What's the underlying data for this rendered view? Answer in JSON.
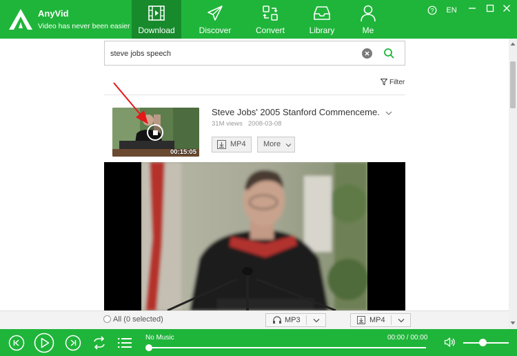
{
  "app": {
    "name": "AnyVid",
    "slogan": "Video has never been easier"
  },
  "nav": {
    "tabs": [
      {
        "label": "Download",
        "icon": "film-icon",
        "active": true
      },
      {
        "label": "Discover",
        "icon": "paper-plane-icon",
        "active": false
      },
      {
        "label": "Convert",
        "icon": "convert-icon",
        "active": false
      },
      {
        "label": "Library",
        "icon": "inbox-icon",
        "active": false
      },
      {
        "label": "Me",
        "icon": "user-icon",
        "active": false
      }
    ]
  },
  "window": {
    "help": "?",
    "language": "EN"
  },
  "search": {
    "value": "steve jobs speech",
    "placeholder": ""
  },
  "filter": {
    "label": "Filter"
  },
  "result": {
    "title": "Steve Jobs' 2005 Stanford Commenceme...",
    "views": "31M views",
    "date": "2008-03-08",
    "duration": "00:15:05",
    "format_button": "MP4",
    "more_button": "More"
  },
  "bottom": {
    "select_all": "All (0 selected)",
    "audio_format": "MP3",
    "video_format": "MP4"
  },
  "player": {
    "now_playing": "No Music",
    "time": "00:00 / 00:00",
    "progress": 0.0,
    "volume": 0.43
  },
  "colors": {
    "brand_green": "#1fb53a",
    "active_tab": "#178a2c",
    "annotation_red": "#e31818"
  }
}
